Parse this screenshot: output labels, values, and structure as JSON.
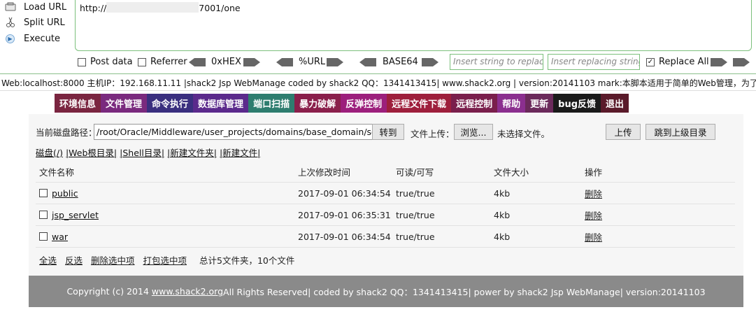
{
  "hackbar": {
    "load_url": "Load URL",
    "split_url": "Split URL",
    "execute": "Execute",
    "url_prefix": "http://",
    "url_suffix": "7001/one",
    "post_data": "Post data",
    "referrer": "Referrer",
    "hex": "0xHEX",
    "url_enc": "%URL",
    "base64": "BASE64",
    "insert_placeholder": "Insert string to replace",
    "replacing_placeholder": "Insert replacing string",
    "replace_all": "Replace All",
    "replace_all_checked": true
  },
  "status": {
    "text": "Web:localhost:8000 主机IP：192.168.11.11 |shack2 Jsp WebManage coded by shack2 QQ：1341413415| www.shack2.org | version:20141103 mark:本脚本适用于简单的Web管理，为了兼容较低"
  },
  "nav": [
    {
      "label": "环境信息",
      "color": "#7a2540"
    },
    {
      "label": "文件管理",
      "color": "#7a2a7e"
    },
    {
      "label": "命令执行",
      "color": "#3a2f7f"
    },
    {
      "label": "数据库管理",
      "color": "#5b2a8c"
    },
    {
      "label": "端口扫描",
      "color": "#2e7d6f"
    },
    {
      "label": "暴力破解",
      "color": "#8a1f4b"
    },
    {
      "label": "反弹控制",
      "color": "#9c1f7c"
    },
    {
      "label": "远程文件下载",
      "color": "#9e1f3c"
    },
    {
      "label": "远程控制",
      "color": "#7a1f4c"
    },
    {
      "label": "帮助",
      "color": "#8b2f8f"
    },
    {
      "label": "更新",
      "color": "#6b2a5b"
    },
    {
      "label": "bug反馈",
      "color": "#1a1a1a"
    },
    {
      "label": "退出",
      "color": "#5a1a2a"
    }
  ],
  "file_manager": {
    "path_label": "当前磁盘路径：",
    "path_value": "/root/Oracle/Middleware/user_projects/domains/base_domain/servers",
    "goto_button": "转到",
    "upload_label": "文件上传：",
    "browse_button": "浏览...",
    "no_file": "未选择文件。",
    "upload_button": "上传",
    "parent_button": "跳到上级目录",
    "links": [
      "磁盘(/)",
      "|Web根目录|",
      "|Shell目录|",
      "|新建文件夹|",
      "|新建文件|"
    ],
    "columns": [
      "文件名称",
      "上次修改时间",
      "可读/可写",
      "文件大小",
      "操作"
    ],
    "rows": [
      {
        "name": "public",
        "modified": "2017-09-01 06:34:54",
        "rw": "true/true",
        "size": "4kb",
        "action": "删除"
      },
      {
        "name": "jsp_servlet",
        "modified": "2017-09-01 06:35:31",
        "rw": "true/true",
        "size": "4kb",
        "action": "删除"
      },
      {
        "name": "war",
        "modified": "2017-09-01 06:34:54",
        "rw": "true/true",
        "size": "4kb",
        "action": "删除"
      }
    ],
    "select_all": "全选",
    "invert": "反选",
    "delete_selected": "删除选中项",
    "pack_selected": "打包选中项",
    "summary": "总计5文件夹，10个文件"
  },
  "footer": {
    "prefix": "Copyright (c) 2014 ",
    "site": "www.shack2.org",
    "suffix": " All Rights Reserved| coded by shack2 QQ：1341413415| power by shack2 Jsp WebManage| version:20141103"
  }
}
